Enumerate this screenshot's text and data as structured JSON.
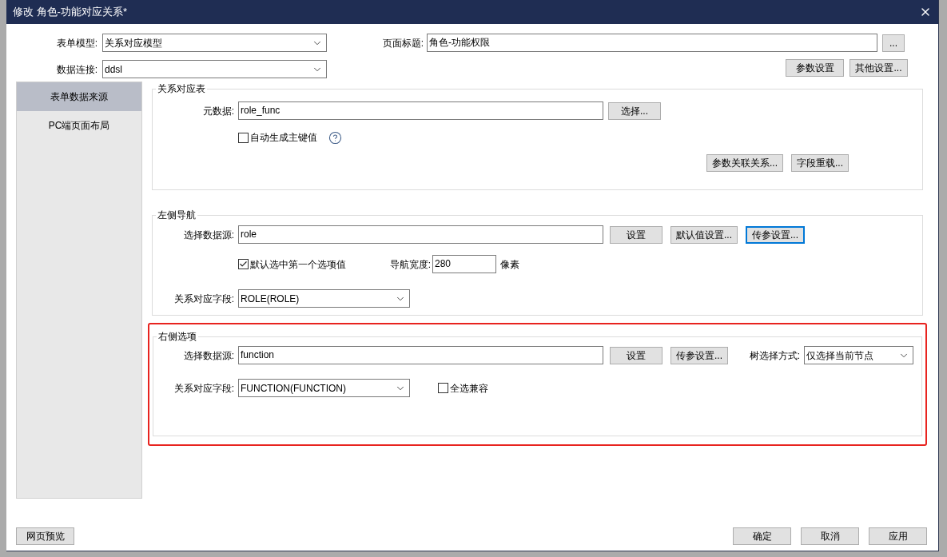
{
  "window": {
    "title": "修改 角色-功能对应关系*"
  },
  "form": {
    "model": {
      "label": "表单模型:",
      "value": "关系对应模型"
    },
    "connection": {
      "label": "数据连接:",
      "value": "ddsl"
    },
    "page_title": {
      "label": "页面标题:",
      "value": "角色-功能权限",
      "browse_button": "..."
    },
    "buttons": [
      "参数设置",
      "其他设置..."
    ]
  },
  "sidebar": {
    "items": [
      {
        "label": "表单数据来源",
        "selected": true
      },
      {
        "label": "PC端页面布局",
        "selected": false
      }
    ]
  },
  "relation_table": {
    "title": "关系对应表",
    "metadata": {
      "label": "元数据:",
      "value": "role_func",
      "button": "选择..."
    },
    "auto_key": {
      "label": "自动生成主键值",
      "checked": false
    },
    "buttons": [
      "参数关联关系...",
      "字段重载..."
    ]
  },
  "left_nav": {
    "title": "左侧导航",
    "source": {
      "label": "选择数据源:",
      "value": "role"
    },
    "buttons": [
      {
        "label": "设置",
        "focused": false
      },
      {
        "label": "默认值设置...",
        "focused": false
      },
      {
        "label": "传参设置...",
        "focused": true
      }
    ],
    "default_first": {
      "label": "默认选中第一个选项值",
      "checked": true
    },
    "nav_width": {
      "label": "导航宽度:",
      "value": "280",
      "unit": "像素"
    },
    "field": {
      "label": "关系对应字段:",
      "value": "ROLE(ROLE)"
    }
  },
  "right_options": {
    "title": "右侧选项",
    "highlighted": true,
    "source": {
      "label": "选择数据源:",
      "value": "function"
    },
    "buttons": [
      {
        "label": "设置",
        "focused": false
      },
      {
        "label": "传参设置...",
        "focused": false
      }
    ],
    "tree_mode": {
      "label": "树选择方式:",
      "value": "仅选择当前节点"
    },
    "field": {
      "label": "关系对应字段:",
      "value": "FUNCTION(FUNCTION)"
    },
    "select_all": {
      "label": "全选兼容",
      "checked": false
    }
  },
  "footer": {
    "preview_button": "网页预览",
    "buttons": [
      "确定",
      "取消",
      "应用"
    ]
  }
}
